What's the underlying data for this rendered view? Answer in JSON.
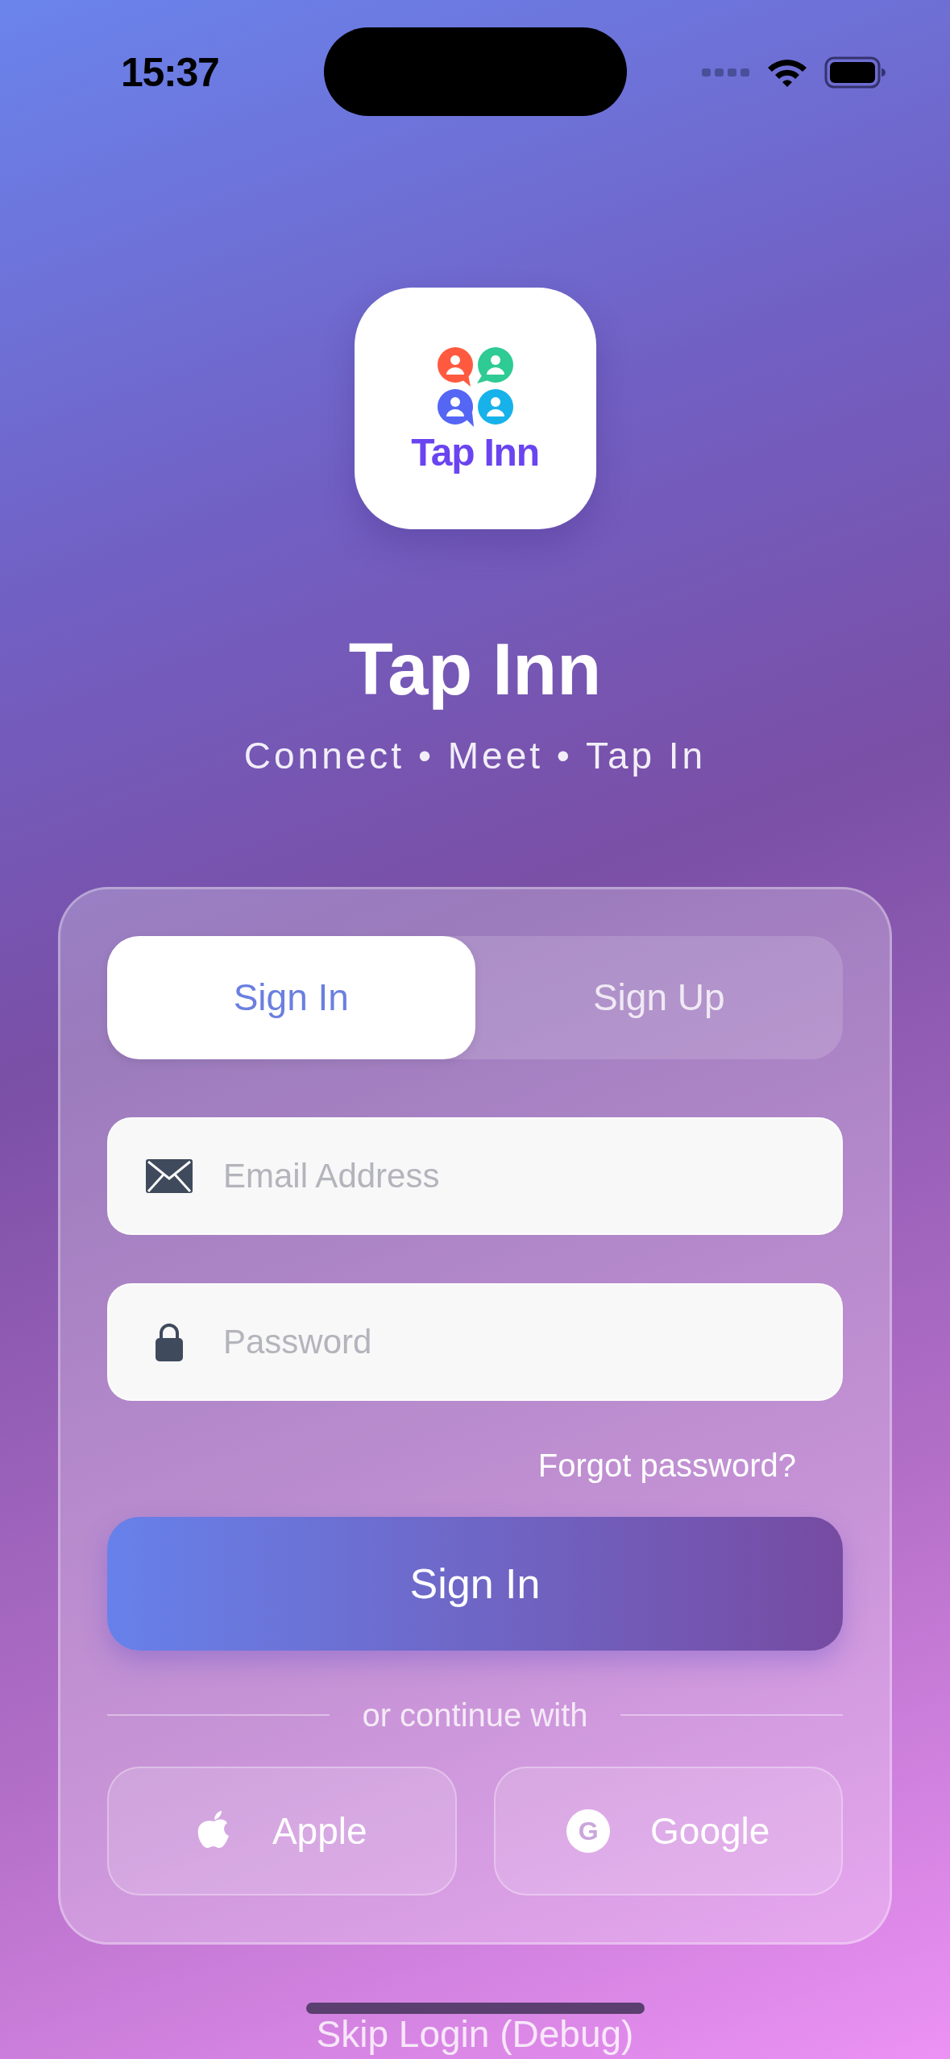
{
  "status_bar": {
    "time": "15:37"
  },
  "app": {
    "logo_text": "Tap Inn",
    "title": "Tap Inn",
    "tagline": "Connect • Meet • Tap In"
  },
  "tabs": [
    {
      "label": "Sign In",
      "selected": true
    },
    {
      "label": "Sign Up",
      "selected": false
    }
  ],
  "fields": [
    {
      "kind": "email",
      "placeholder": "Email Address"
    },
    {
      "kind": "password",
      "placeholder": "Password"
    }
  ],
  "forgot_link": "Forgot password?",
  "submit_button": "Sign In",
  "divider_text": "or continue with",
  "social_buttons": [
    {
      "kind": "apple",
      "label": "Apple"
    },
    {
      "kind": "google",
      "label": "Google",
      "badge": "G"
    }
  ],
  "skip_link": "Skip Login (Debug)"
}
